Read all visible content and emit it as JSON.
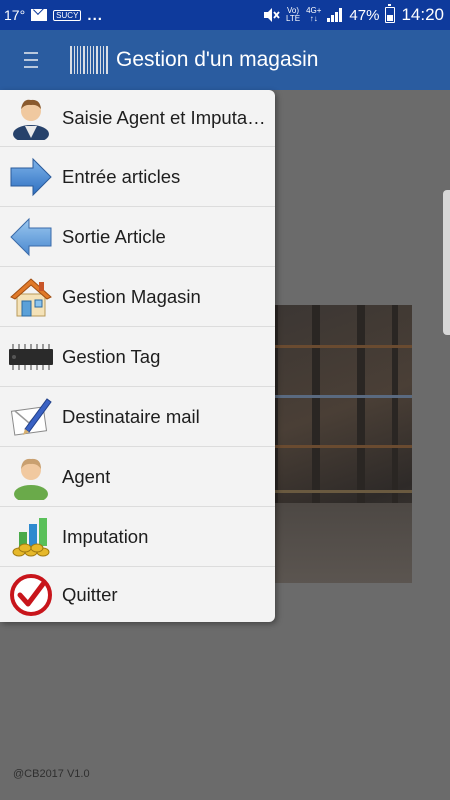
{
  "status_bar": {
    "temperature": "17°",
    "badge": "SUCY",
    "dots": "...",
    "volte_line1": "Vo)",
    "volte_line2": "LTE",
    "network_line1": "4G+",
    "network_line2": "↑↓",
    "battery": "47%",
    "time": "14:20"
  },
  "app_bar": {
    "title": "Gestion d'un magasin"
  },
  "menu": {
    "items": [
      {
        "label": "Saisie Agent et Imputation",
        "icon": "agent-imputation-icon"
      },
      {
        "label": "Entrée articles",
        "icon": "arrow-right-icon"
      },
      {
        "label": "Sortie Article",
        "icon": "arrow-left-icon"
      },
      {
        "label": "Gestion Magasin",
        "icon": "house-icon"
      },
      {
        "label": "Gestion Tag",
        "icon": "chip-icon"
      },
      {
        "label": "Destinataire mail",
        "icon": "mail-pen-icon"
      },
      {
        "label": "Agent",
        "icon": "person-icon"
      },
      {
        "label": "Imputation",
        "icon": "coins-chart-icon"
      },
      {
        "label": "Quitter",
        "icon": "check-circle-icon"
      }
    ]
  },
  "footer": {
    "copyright": "@CB2017 V1.0"
  },
  "colors": {
    "status_bar": "#0e3a9c",
    "app_bar": "#2a5ca0",
    "menu_bg": "#f3f3f3",
    "scrim": "#6b6b6b"
  }
}
